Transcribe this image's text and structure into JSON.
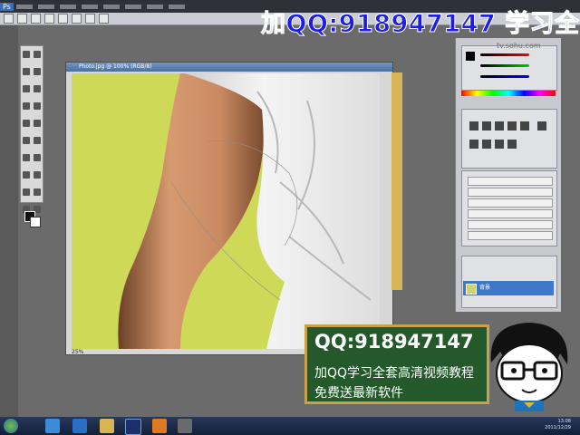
{
  "watermark": {
    "top_text": "加QQ:918947147 学习全",
    "site": "tv.sohu.com",
    "board_line1": "QQ:918947147",
    "board_line2": "加QQ学习全套高清视频教程",
    "board_line3": "免费送最新软件"
  },
  "document": {
    "title": "Photo.jpg @ 100% (RGB/8)",
    "zoom": "25%"
  },
  "layers": {
    "items": [
      "背景"
    ]
  },
  "taskbar": {
    "time": "13:08",
    "date": "2011/12/29"
  },
  "colors": {
    "canvas": "#ced958",
    "title_blue": "#1c1ee6",
    "board_green": "#245a2b",
    "layer_select": "#3f78c8"
  }
}
